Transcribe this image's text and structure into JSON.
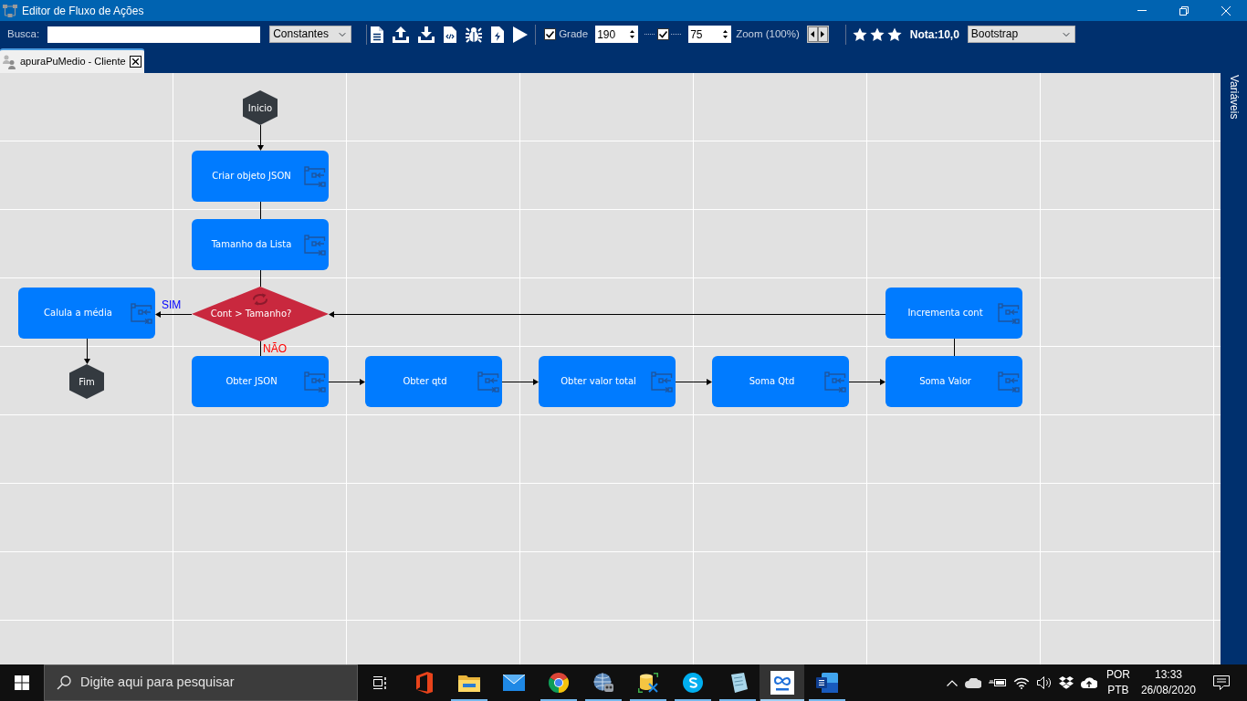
{
  "window": {
    "title": "Editor de Fluxo de Ações"
  },
  "toolbar": {
    "search_label": "Busca:",
    "category": "Constantes",
    "grid": {
      "checked": true,
      "label": "Grade",
      "size": "190"
    },
    "snap": {
      "checked": true,
      "size": "75"
    },
    "zoom_label": "Zoom (100%)",
    "rating": {
      "stars": 3,
      "label": "Nota:10,0"
    },
    "theme": "Bootstrap"
  },
  "tabs": [
    {
      "label": "apuraPuMedio - Cliente",
      "selected": true
    }
  ],
  "flow": {
    "nodes": [
      {
        "kind": "terminal",
        "label": "Inicio"
      },
      {
        "kind": "action",
        "label": "Criar objeto JSON"
      },
      {
        "kind": "action",
        "label": "Tamanho da Lista"
      },
      {
        "kind": "action",
        "label": "Calula a média"
      },
      {
        "kind": "decision",
        "label": "Cont > Tamanho?",
        "yes_label": "SIM",
        "no_label": "NÃO"
      },
      {
        "kind": "action",
        "label": "Incrementa cont"
      },
      {
        "kind": "terminal",
        "label": "Fim"
      },
      {
        "kind": "action",
        "label": "Obter JSON"
      },
      {
        "kind": "action",
        "label": "Obter qtd"
      },
      {
        "kind": "action",
        "label": "Obter valor total"
      },
      {
        "kind": "action",
        "label": "Soma Qtd"
      },
      {
        "kind": "action",
        "label": "Soma Valor"
      }
    ]
  },
  "side_panel": {
    "label": "Variáveis"
  },
  "taskbar": {
    "search_placeholder": "Digite aqui para pesquisar",
    "apps": [
      {
        "kind": "office",
        "running": false,
        "selected": false
      },
      {
        "kind": "explorer",
        "running": true,
        "selected": false
      },
      {
        "kind": "mail",
        "running": false,
        "selected": false
      },
      {
        "kind": "browser",
        "running": true,
        "selected": false
      },
      {
        "kind": "globe",
        "running": true,
        "selected": false
      },
      {
        "kind": "database",
        "running": true,
        "selected": false
      },
      {
        "kind": "chat",
        "running": true,
        "selected": false
      },
      {
        "kind": "notepad",
        "running": true,
        "selected": false
      },
      {
        "kind": "maker",
        "running": true,
        "selected": true
      },
      {
        "kind": "word",
        "running": true,
        "selected": false
      }
    ],
    "language": [
      "POR",
      "PTB"
    ],
    "time": "13:33",
    "date": "26/08/2020"
  }
}
